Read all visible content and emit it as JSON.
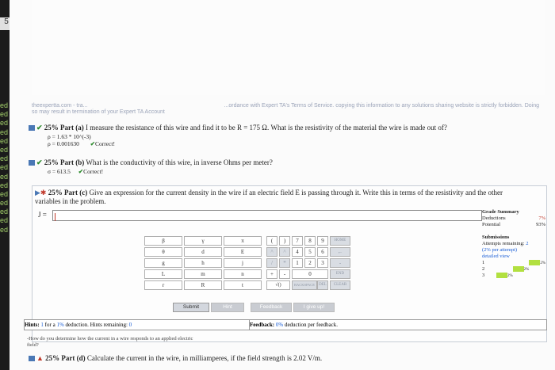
{
  "gutter": {
    "tab_number": "5",
    "cut_marks": [
      "ed",
      "ed",
      "ed",
      "ed",
      "ed",
      "ed",
      "ed",
      "ed",
      "ed",
      "ed",
      "ed",
      "ed",
      "ed",
      "ed",
      "ed"
    ]
  },
  "notice": {
    "left": "theexpertta.com - tra...",
    "left2": "so may result in termination of your Expert TA Account",
    "right": "...ordance with Expert TA's Terms of Service. copying this information to any solutions sharing website is strictly forbidden. Doing"
  },
  "partA": {
    "label": "25% Part (a)",
    "text": "I measure the resistance of this wire and find it to be R = 175 Ω. What is the resistivity of the material the wire is made out of?",
    "answer1": "ρ = 1.63 * 10^(-3)",
    "answer2": "ρ = 0.001630",
    "status": "Correct!"
  },
  "partB": {
    "label": "25% Part (b)",
    "text": "What is the conductivity of this wire, in inverse Ohms per meter?",
    "answer": "σ = 613.5",
    "status": "Correct!"
  },
  "partC": {
    "label": "25% Part (c)",
    "text1": "Give an expression for the current density in the wire if an electric field E is passing through it. Write this in terms of the resistivity and the other",
    "text2": "variables in the problem.",
    "input_prefix": "J =",
    "input_value": ""
  },
  "keyboard": {
    "greek": [
      "β",
      "γ",
      "π",
      "θ",
      "d",
      "E",
      "g",
      "h",
      "j",
      "L",
      "m",
      "n",
      "r",
      "R",
      "t"
    ],
    "digits": [
      "7",
      "8",
      "9",
      "4",
      "5",
      "6",
      "1",
      "2",
      "3",
      "0"
    ],
    "special": [
      "(",
      ")",
      "HOME",
      "^",
      "^",
      "/",
      "*",
      "-",
      "+",
      "-",
      ".",
      "END",
      "√()",
      "BACKSPACE",
      "DEL",
      "CLEAR"
    ]
  },
  "actions": {
    "submit": "Submit",
    "hint": "Hint",
    "feedback": "Feedback",
    "give_up": "I give up!"
  },
  "hints": {
    "prefix": "Hints:",
    "count": "1",
    "for_a": "for a",
    "pct": "1%",
    "suffix": "deduction. Hints remaining:",
    "remaining": "0"
  },
  "feedback": {
    "prefix": "Feedback:",
    "pct": "0%",
    "suffix": "deduction per feedback."
  },
  "hint_text": {
    "line1": "-How do you determine how the current in a wire responds to an applied electric",
    "line2": "field?"
  },
  "partD": {
    "label": "25% Part (d)",
    "text": "Calculate the current in the wire, in milliamperes, if the field strength is 2.02 V/m."
  },
  "grade": {
    "title": "Grade Summary",
    "deductions_label": "Deductions",
    "deductions": "7%",
    "potential_label": "Potential",
    "potential": "93%",
    "submissions_title": "Submissions",
    "attempts_label": "Attempts remaining:",
    "attempts": "2",
    "per_attempt": "(2% per attempt)",
    "detailed": "detailed view",
    "rows": [
      {
        "n": "1",
        "v": "2%"
      },
      {
        "n": "2",
        "v": "2%"
      },
      {
        "n": "3",
        "v": "2%"
      }
    ]
  }
}
